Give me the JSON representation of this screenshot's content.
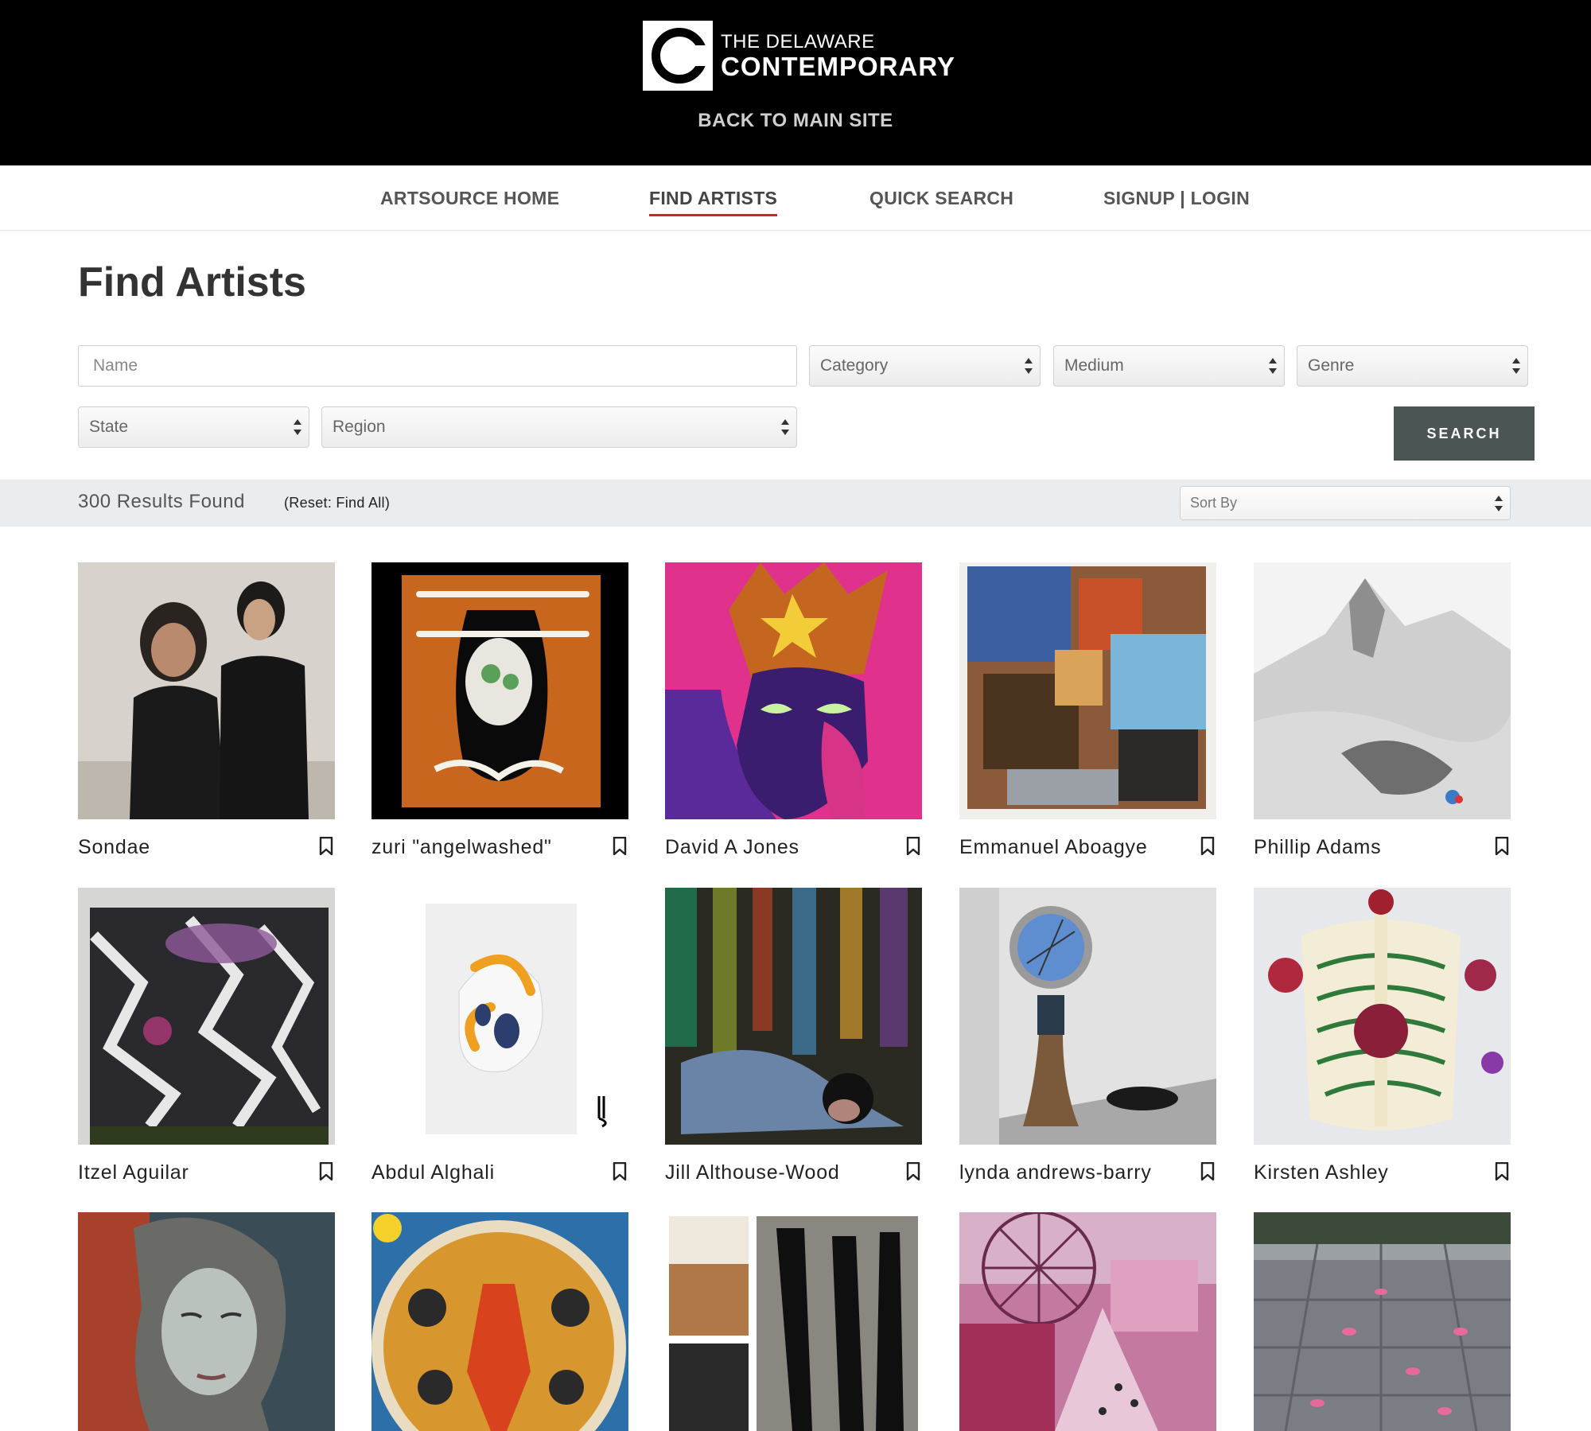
{
  "header": {
    "logo_letter": "C",
    "logo_line1": "THE DELAWARE",
    "logo_line2": "CONTEMPORARY",
    "back_link": "BACK TO MAIN SITE"
  },
  "nav": {
    "items": [
      {
        "label": "ARTSOURCE HOME"
      },
      {
        "label": "FIND ARTISTS"
      },
      {
        "label": "QUICK SEARCH"
      },
      {
        "label": "SIGNUP | LOGIN"
      }
    ],
    "active": "FIND ARTISTS",
    "active_underline_color": "#c6282f"
  },
  "page": {
    "title": "Find Artists"
  },
  "filters": {
    "name_placeholder": "Name",
    "category": "Category",
    "medium": "Medium",
    "genre": "Genre",
    "state": "State",
    "region": "Region",
    "search_label": "SEARCH",
    "search_color": "#4b5654"
  },
  "results": {
    "count_text": "300 Results Found",
    "reset_text": "(Reset: Find All)",
    "sort_placeholder": "Sort By"
  },
  "artists": [
    {
      "name": "Sondae",
      "bookmark_icon": "bookmark-icon"
    },
    {
      "name": "zuri \"angelwashed\"",
      "bookmark_icon": "bookmark-icon"
    },
    {
      "name": "David A Jones",
      "bookmark_icon": "bookmark-icon"
    },
    {
      "name": "Emmanuel Aboagye",
      "bookmark_icon": "bookmark-icon"
    },
    {
      "name": "Phillip Adams",
      "bookmark_icon": "bookmark-icon"
    },
    {
      "name": "Itzel Aguilar",
      "bookmark_icon": "bookmark-icon"
    },
    {
      "name": "Abdul Alghali",
      "bookmark_icon": "bookmark-icon"
    },
    {
      "name": "Jill Althouse-Wood",
      "bookmark_icon": "bookmark-icon"
    },
    {
      "name": "lynda andrews-barry",
      "bookmark_icon": "bookmark-icon"
    },
    {
      "name": "Kirsten Ashley",
      "bookmark_icon": "bookmark-icon"
    },
    {
      "name": "",
      "bookmark_icon": "bookmark-icon"
    },
    {
      "name": "",
      "bookmark_icon": "bookmark-icon"
    },
    {
      "name": "",
      "bookmark_icon": "bookmark-icon"
    },
    {
      "name": "",
      "bookmark_icon": "bookmark-icon"
    },
    {
      "name": "",
      "bookmark_icon": "bookmark-icon"
    }
  ],
  "icons": {
    "select_arrows": "select-arrows-icon",
    "bookmark": "bookmark-icon"
  }
}
